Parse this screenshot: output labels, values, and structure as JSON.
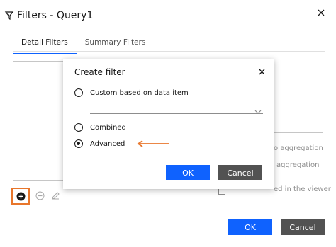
{
  "dialog": {
    "title": "Filters - Query1",
    "tabs": [
      {
        "label": "Detail Filters",
        "active": true
      },
      {
        "label": "Summary Filters",
        "active": false
      }
    ],
    "background_text": [
      "o aggregation",
      "aggregation",
      "ed in the viewer"
    ],
    "ok_label": "OK",
    "cancel_label": "Cancel"
  },
  "modal": {
    "title": "Create filter",
    "options": [
      {
        "label": "Custom based on data item",
        "selected": false
      },
      {
        "label": "Combined",
        "selected": false
      },
      {
        "label": "Advanced",
        "selected": true
      }
    ],
    "select_value": "",
    "ok_label": "OK",
    "cancel_label": "Cancel"
  },
  "colors": {
    "primary": "#0f62fe",
    "secondary": "#525252",
    "highlight": "#e8762b"
  },
  "icons": {
    "title": "filter-icon",
    "close": "close-icon",
    "add": "add-circle-icon",
    "remove": "remove-circle-icon",
    "edit": "pencil-icon",
    "dropdown": "chevron-down-icon",
    "annotation": "arrow-left-icon"
  }
}
